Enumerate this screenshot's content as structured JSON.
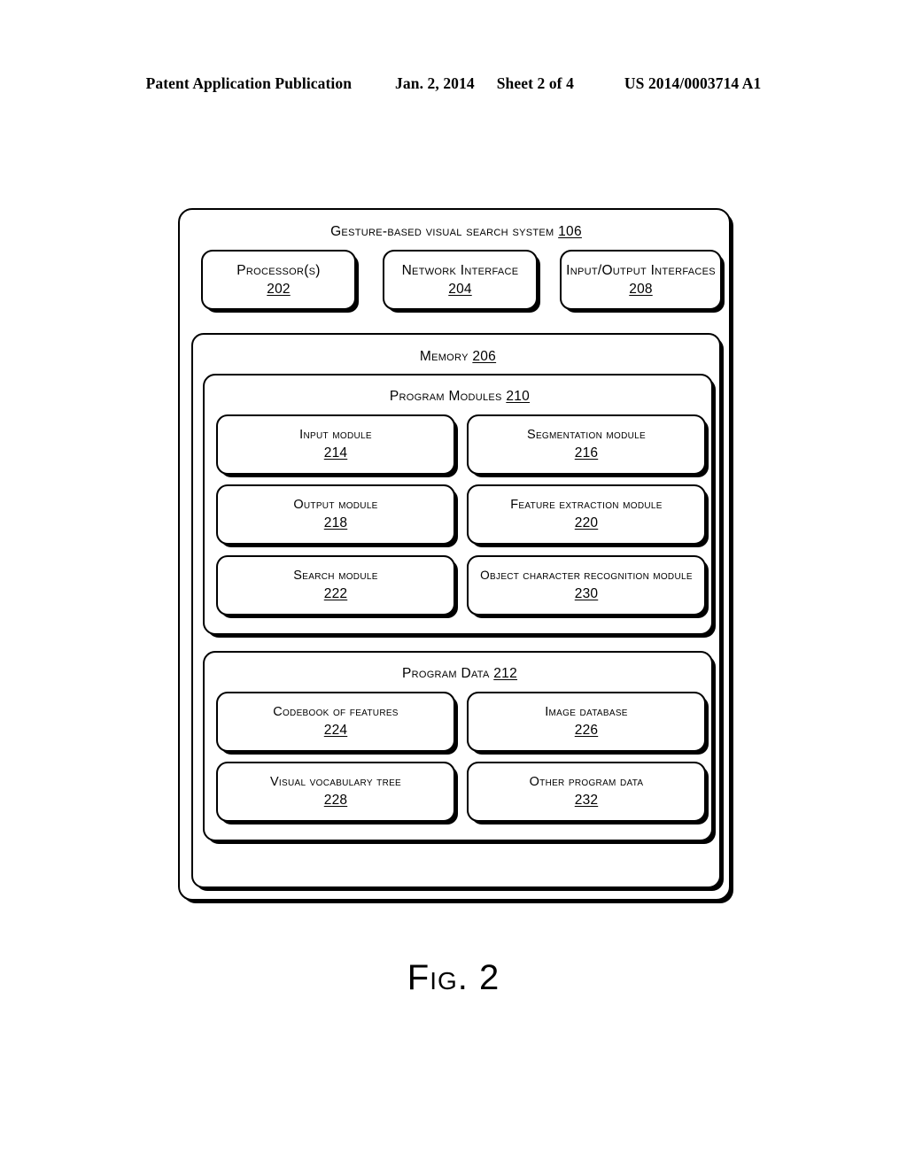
{
  "header": {
    "publication": "Patent Application Publication",
    "date": "Jan. 2, 2014",
    "sheet": "Sheet 2 of 4",
    "patent_number": "US 2014/0003714 A1"
  },
  "figure": {
    "caption": "Fig. 2",
    "system": {
      "title": "Gesture-based visual search system",
      "ref": "106"
    },
    "top_row": [
      {
        "label": "Processor(s)",
        "ref": "202"
      },
      {
        "label": "Network Interface",
        "ref": "204"
      },
      {
        "label": "Input/Output Interfaces",
        "ref": "208"
      }
    ],
    "memory": {
      "title": "Memory",
      "ref": "206",
      "program_modules": {
        "title": "Program Modules",
        "ref": "210",
        "items": [
          {
            "label": "Input module",
            "ref": "214"
          },
          {
            "label": "Segmentation module",
            "ref": "216"
          },
          {
            "label": "Output module",
            "ref": "218"
          },
          {
            "label": "Feature extraction module",
            "ref": "220"
          },
          {
            "label": "Search module",
            "ref": "222"
          },
          {
            "label": "Object character recognition module",
            "ref": "230"
          }
        ]
      },
      "program_data": {
        "title": "Program Data",
        "ref": "212",
        "items": [
          {
            "label": "Codebook of features",
            "ref": "224"
          },
          {
            "label": "Image database",
            "ref": "226"
          },
          {
            "label": "Visual vocabulary tree",
            "ref": "228"
          },
          {
            "label": "Other program data",
            "ref": "232"
          }
        ]
      }
    }
  }
}
